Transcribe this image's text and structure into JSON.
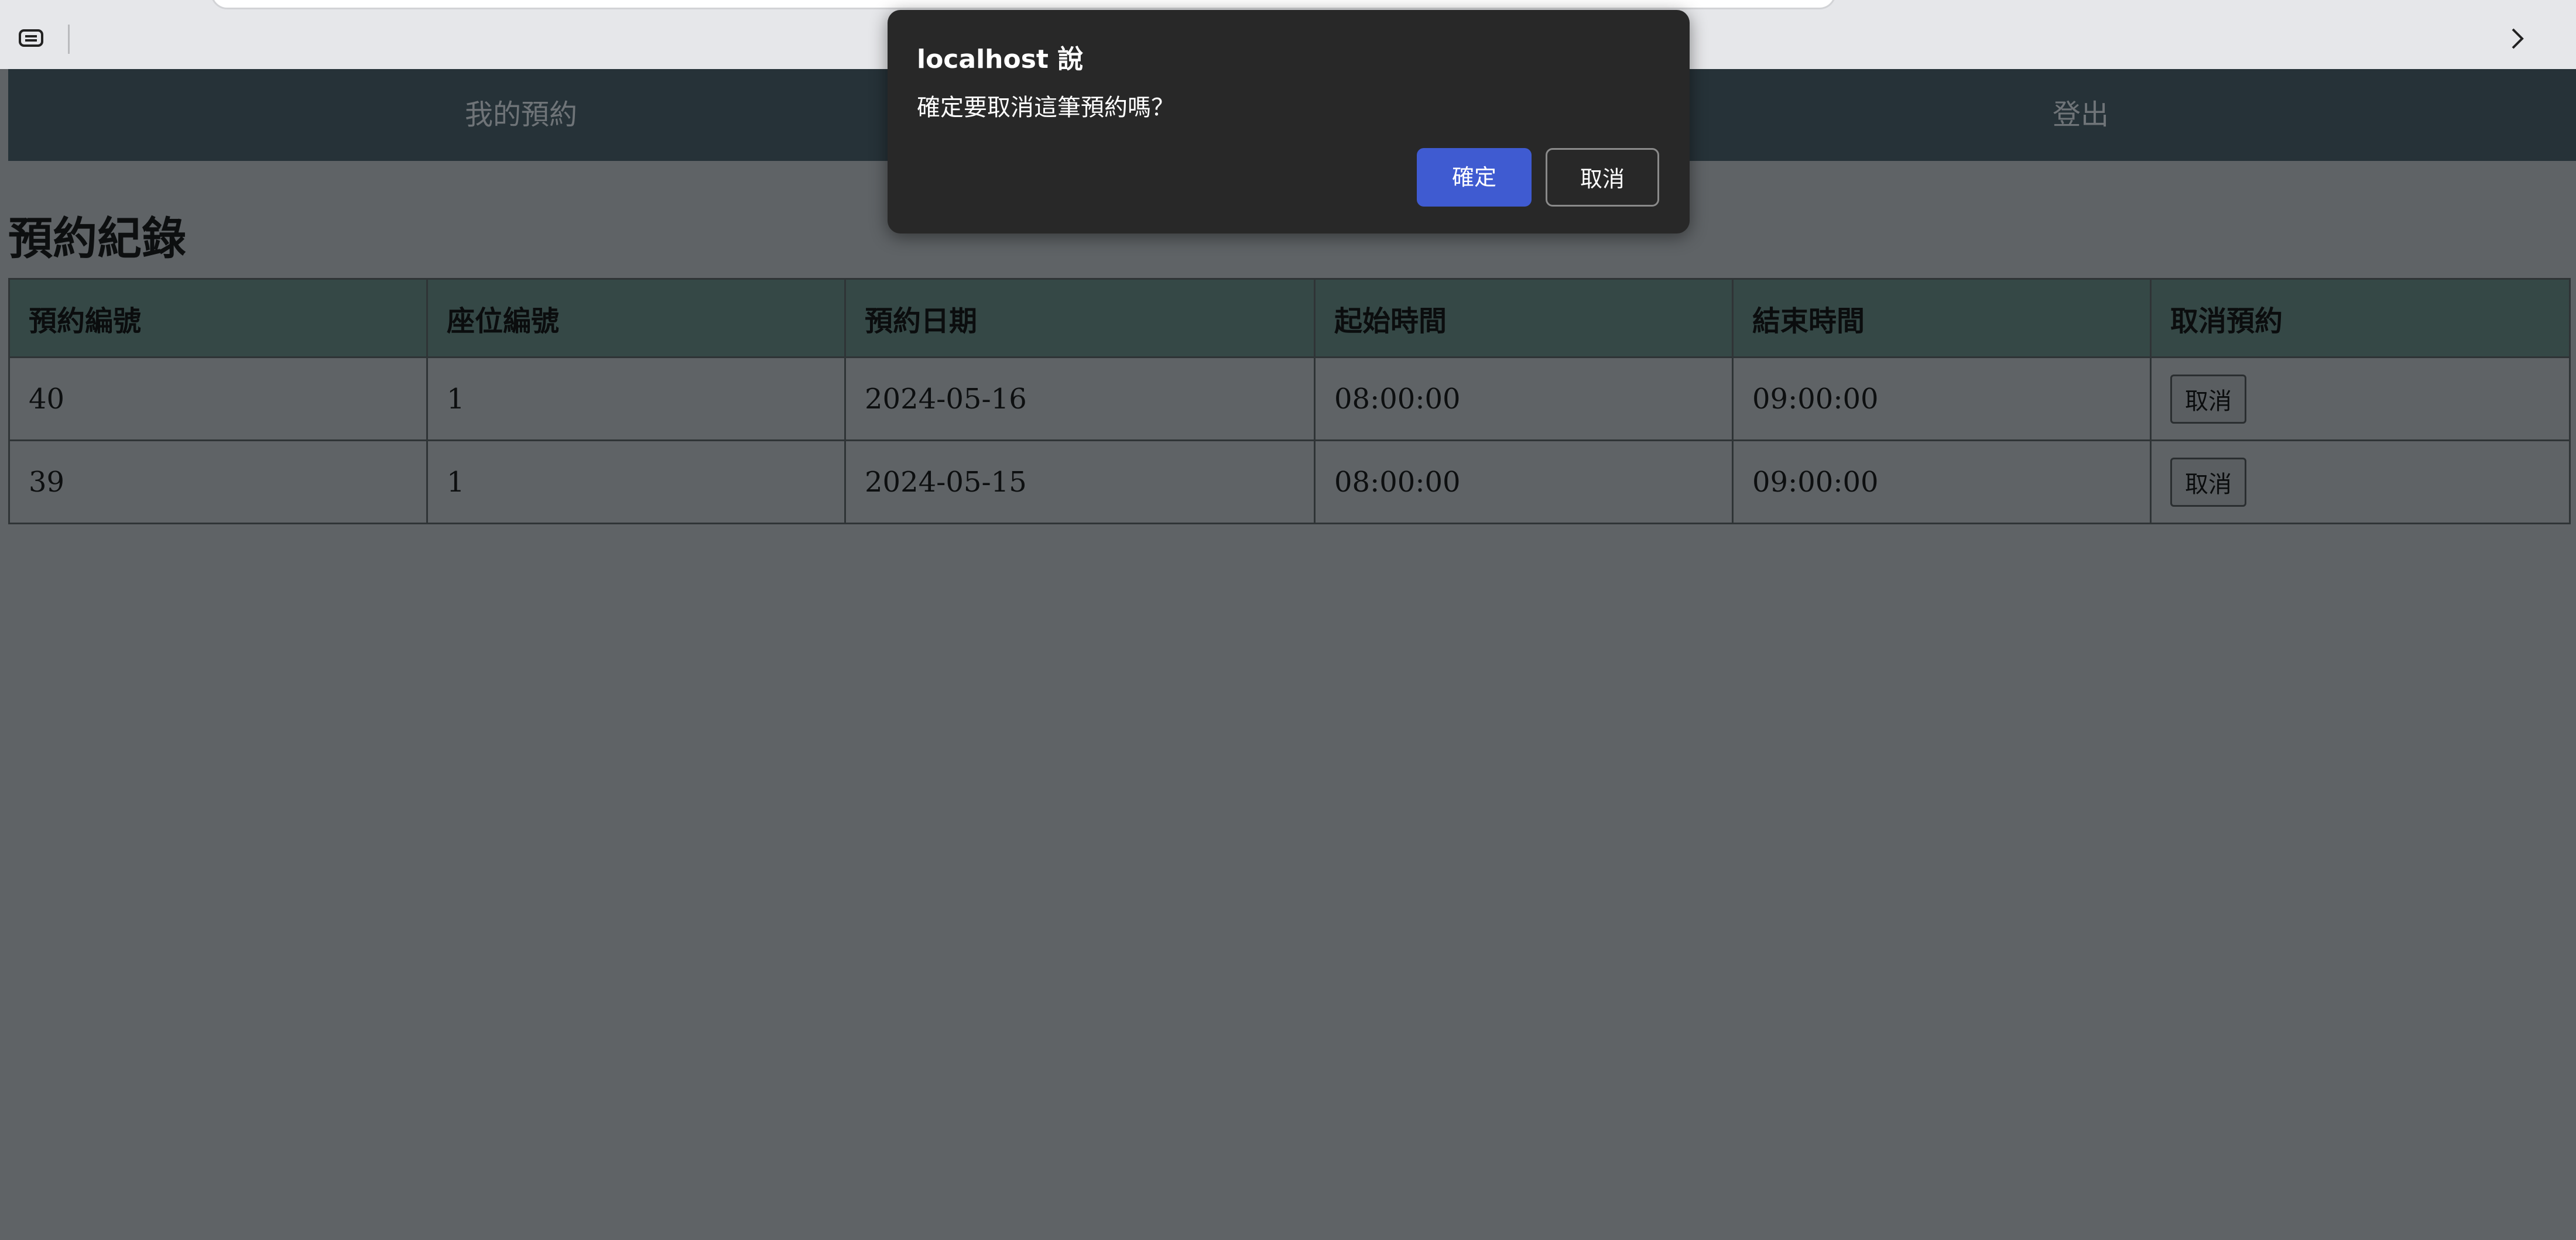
{
  "nav": {
    "my_bookings": "我的預約",
    "logout": "登出"
  },
  "page": {
    "title": "預約紀錄"
  },
  "table": {
    "headers": [
      "預約編號",
      "座位編號",
      "預約日期",
      "起始時間",
      "結束時間",
      "取消預約"
    ],
    "rows": [
      {
        "id": "40",
        "seat": "1",
        "date": "2024-05-16",
        "start": "08:00:00",
        "end": "09:00:00",
        "action": "取消"
      },
      {
        "id": "39",
        "seat": "1",
        "date": "2024-05-15",
        "start": "08:00:00",
        "end": "09:00:00",
        "action": "取消"
      }
    ]
  },
  "dialog": {
    "title": "localhost 說",
    "message": "確定要取消這筆預約嗎？",
    "ok_label": "確定",
    "cancel_label": "取消"
  },
  "colors": {
    "navbar": "#263238",
    "table_header": "#354846",
    "dialog_bg": "#282828",
    "primary_button": "#3f5bd1"
  }
}
